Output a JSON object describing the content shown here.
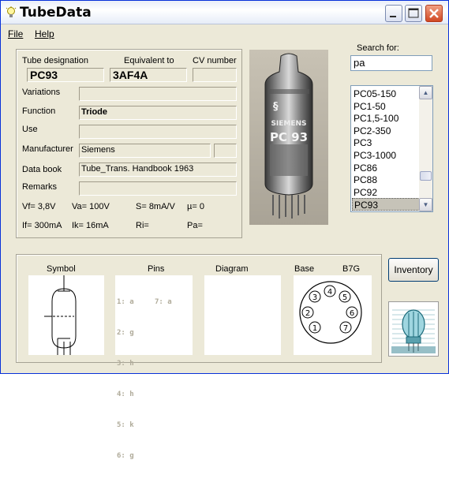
{
  "window": {
    "title": "TubeData"
  },
  "menu": {
    "file": "File",
    "help": "Help"
  },
  "form": {
    "tube_designation_label": "Tube designation",
    "equivalent_label": "Equivalent to",
    "cv_label": "CV number",
    "tube_designation": "PC93",
    "equivalent": "3AF4A",
    "cv_number": "",
    "variations_label": "Variations",
    "variations": "",
    "function_label": "Function",
    "function": "Triode",
    "use_label": "Use",
    "use": "",
    "manufacturer_label": "Manufacturer",
    "manufacturer": "Siemens",
    "manufacturer_extra": "",
    "databook_label": "Data book",
    "databook": "Tube_Trans. Handbook 1963",
    "remarks_label": "Remarks",
    "remarks": "",
    "params_row1": {
      "vf": "Vf= 3,8V",
      "va": "Va= 100V",
      "s": "S= 8mA/V",
      "mu": "µ=   0"
    },
    "params_row2": {
      "if": "If= 300mA",
      "ik": "Ik=  16mA",
      "ri": "Ri=",
      "pa": "Pa="
    }
  },
  "photo": {
    "brand": "SIEMENS",
    "type": "PC 93"
  },
  "search": {
    "label": "Search for:",
    "value": "pa"
  },
  "results": [
    "PC05-150",
    "PC1-50",
    "PC1,5-100",
    "PC2-350",
    "PC3",
    "PC3-1000",
    "PC86",
    "PC88",
    "PC92",
    "PC93"
  ],
  "results_selected": "PC93",
  "bottom": {
    "symbol_label": "Symbol",
    "pins_label": "Pins",
    "diagram_label": "Diagram",
    "base_label": "Base",
    "base_type": "B7G",
    "pins_col1": [
      "1: a",
      "2: g",
      "3: h",
      "4: h",
      "5: k",
      "6: g"
    ],
    "pins_col2": [
      "7: a"
    ],
    "base_pins": [
      "1",
      "2",
      "3",
      "4",
      "5",
      "6",
      "7"
    ]
  },
  "buttons": {
    "inventory": "Inventory"
  }
}
